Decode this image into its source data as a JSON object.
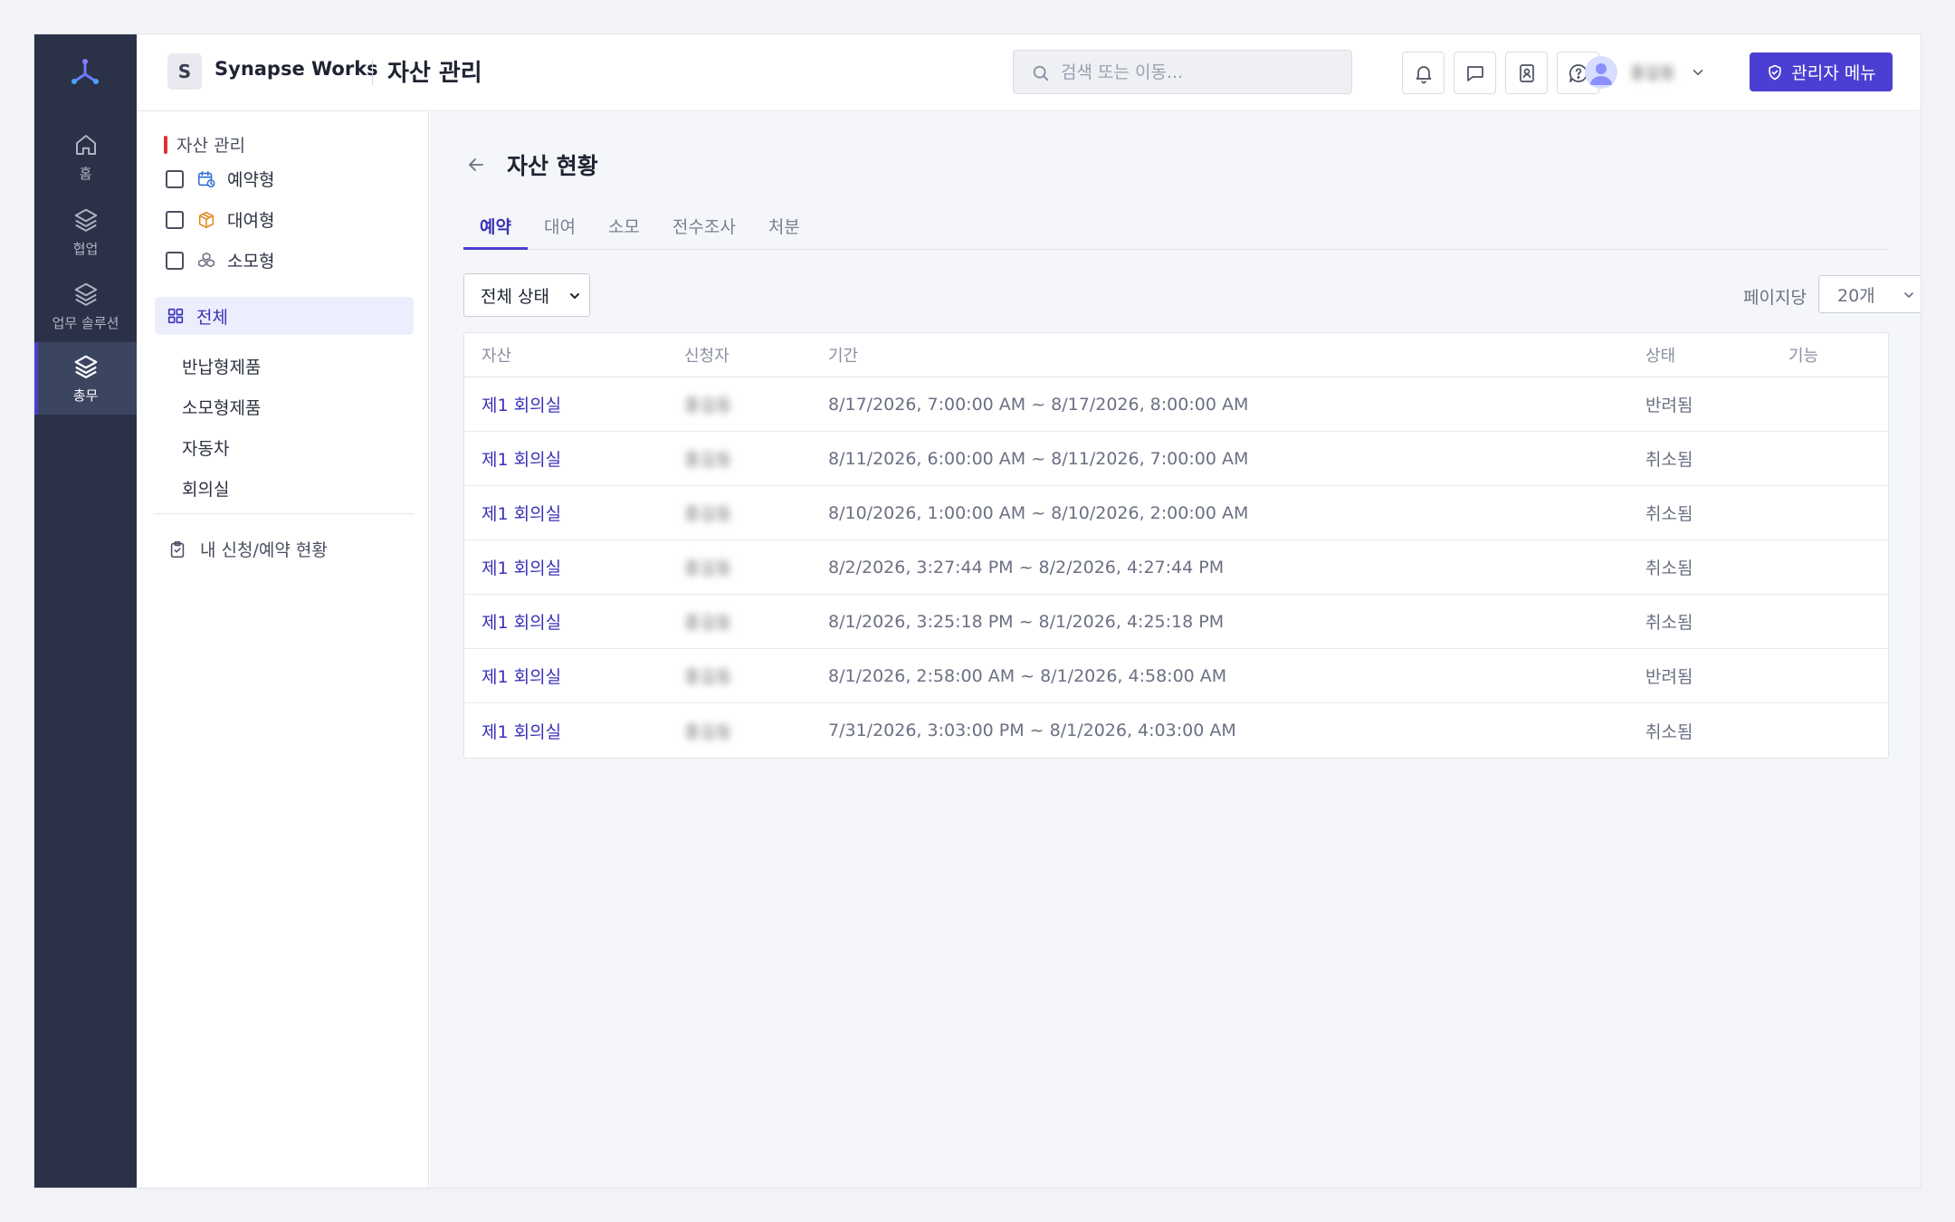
{
  "rail": {
    "items": [
      {
        "label": "홈",
        "icon": "home-icon"
      },
      {
        "label": "협업",
        "icon": "layers-icon"
      },
      {
        "label": "업무 솔루션",
        "icon": "layers-icon"
      },
      {
        "label": "총무",
        "icon": "layers-icon",
        "active": true
      }
    ]
  },
  "header": {
    "org_initial": "S",
    "org_name": "Synapse Works",
    "page_title": "자산 관리",
    "search_placeholder": "검색 또는 이동...",
    "user_name": "홍길동",
    "admin_label": "관리자 메뉴"
  },
  "sidebar": {
    "section_title": "자산 관리",
    "filters": [
      {
        "label": "예약형",
        "icon": "calendar-clock-icon"
      },
      {
        "label": "대여형",
        "icon": "box-icon"
      },
      {
        "label": "소모형",
        "icon": "cubes-icon"
      }
    ],
    "all_label": "전체",
    "sub_items": [
      "반납형제품",
      "소모형제품",
      "자동차",
      "회의실"
    ],
    "my_requests_label": "내 신청/예약 현황"
  },
  "main": {
    "title": "자산 현황",
    "tabs": [
      "예약",
      "대여",
      "소모",
      "전수조사",
      "처분"
    ],
    "active_tab": "예약",
    "status_filter": "전체 상태",
    "per_page_label": "페이지당",
    "per_page_value": "20개",
    "columns": [
      "자산",
      "신청자",
      "기간",
      "상태",
      "기능"
    ],
    "rows": [
      {
        "asset": "제1 회의실",
        "applicant": "홍길동",
        "period": "8/17/2026, 7:00:00 AM ~ 8/17/2026, 8:00:00 AM",
        "status": "반려됨"
      },
      {
        "asset": "제1 회의실",
        "applicant": "홍길동",
        "period": "8/11/2026, 6:00:00 AM ~ 8/11/2026, 7:00:00 AM",
        "status": "취소됨"
      },
      {
        "asset": "제1 회의실",
        "applicant": "홍길동",
        "period": "8/10/2026, 1:00:00 AM ~ 8/10/2026, 2:00:00 AM",
        "status": "취소됨"
      },
      {
        "asset": "제1 회의실",
        "applicant": "홍길동",
        "period": "8/2/2026, 3:27:44 PM ~ 8/2/2026, 4:27:44 PM",
        "status": "취소됨"
      },
      {
        "asset": "제1 회의실",
        "applicant": "홍길동",
        "period": "8/1/2026, 3:25:18 PM ~ 8/1/2026, 4:25:18 PM",
        "status": "취소됨"
      },
      {
        "asset": "제1 회의실",
        "applicant": "홍길동",
        "period": "8/1/2026, 2:58:00 AM ~ 8/1/2026, 4:58:00 AM",
        "status": "반려됨"
      },
      {
        "asset": "제1 회의실",
        "applicant": "홍길동",
        "period": "7/31/2026, 3:03:00 PM ~ 8/1/2026, 4:03:00 AM",
        "status": "취소됨"
      }
    ]
  },
  "colors": {
    "accent": "#4b3fd3",
    "rail_bg": "#2b3146",
    "section_marker": "#e03131"
  }
}
